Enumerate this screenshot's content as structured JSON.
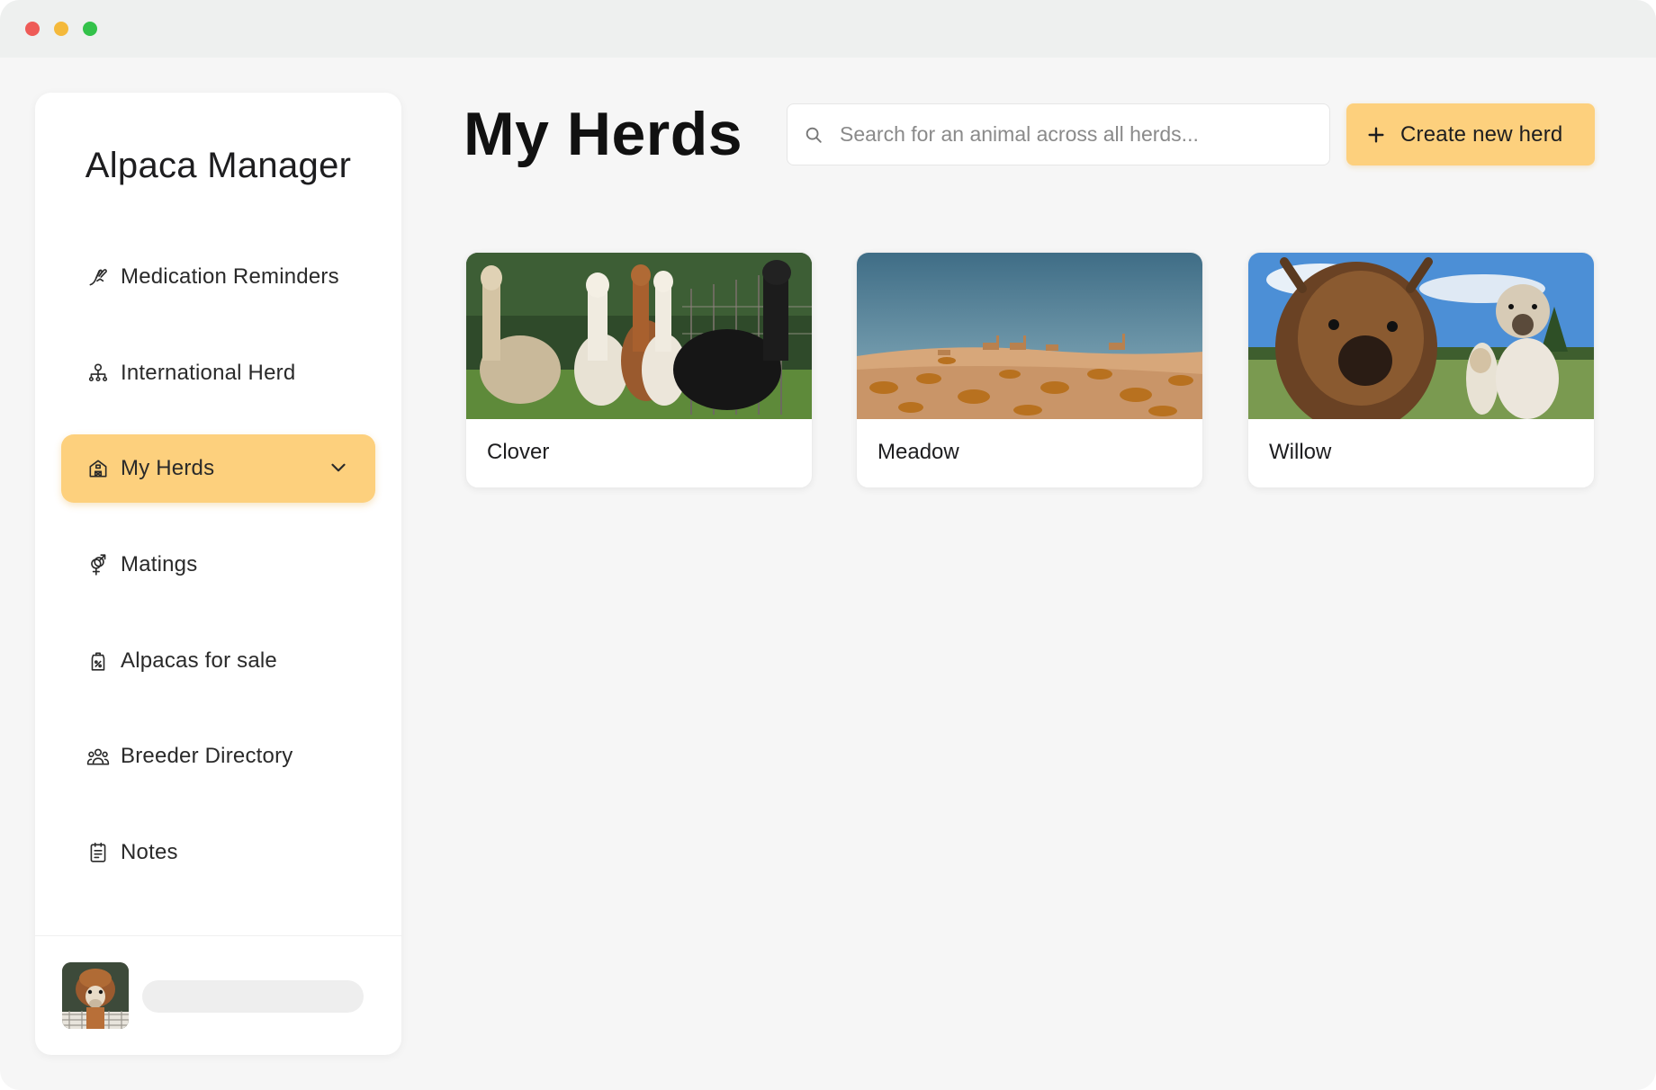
{
  "app": {
    "title": "Alpaca Manager"
  },
  "sidebar": {
    "items": [
      {
        "label": "Medication Reminders",
        "icon": "medication-icon",
        "active": false
      },
      {
        "label": "International Herd",
        "icon": "network-icon",
        "active": false
      },
      {
        "label": "My Herds",
        "icon": "barn-icon",
        "active": true,
        "expandable": true
      },
      {
        "label": "Matings",
        "icon": "gender-icon",
        "active": false
      },
      {
        "label": "Alpacas for sale",
        "icon": "price-tag-icon",
        "active": false
      },
      {
        "label": "Breeder Directory",
        "icon": "group-icon",
        "active": false
      },
      {
        "label": "Notes",
        "icon": "notes-icon",
        "active": false
      }
    ],
    "user": {
      "avatar": "alpaca-avatar"
    }
  },
  "main": {
    "title": "My Herds",
    "search": {
      "placeholder": "Search for an animal across all herds...",
      "value": ""
    },
    "create_button": {
      "label": "Create new herd"
    },
    "herds": [
      {
        "name": "Clover",
        "image": "alpacas-in-green-field"
      },
      {
        "name": "Meadow",
        "image": "vicunas-in-desert"
      },
      {
        "name": "Willow",
        "image": "alpaca-closeup-selfie"
      }
    ]
  },
  "colors": {
    "accent": "#fdd07d",
    "background": "#f6f6f6",
    "text": "#1d1d1f"
  }
}
